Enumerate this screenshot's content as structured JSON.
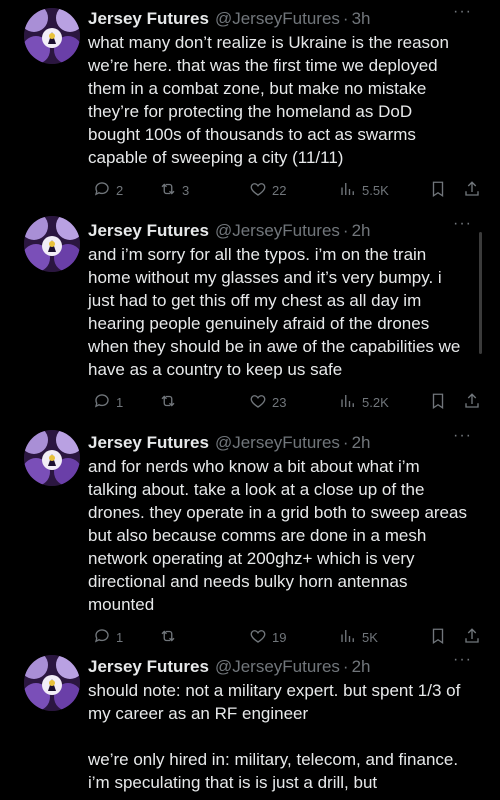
{
  "tweets": [
    {
      "name": "Jersey Futures",
      "handle": "@JerseyFutures",
      "time": "3h",
      "text": "what many don’t realize is Ukraine is the reason we’re here. that was the first time we deployed them in a combat zone, but make no mistake they’re for protecting the homeland as DoD bought 100s of thousands to act as swarms capable of sweeping a city (11/11)",
      "replies": "2",
      "retweets": "3",
      "likes": "22",
      "views": "5.5K"
    },
    {
      "name": "Jersey Futures",
      "handle": "@JerseyFutures",
      "time": "2h",
      "text": "and i’m sorry for all the typos. i’m on the train home without my glasses and it’s very bumpy. i just had to get this off my chest as all day im hearing people genuinely afraid of the drones when they should be in awe of the capabilities we have as a country to keep us safe",
      "replies": "1",
      "retweets": "",
      "likes": "23",
      "views": "5.2K"
    },
    {
      "name": "Jersey Futures",
      "handle": "@JerseyFutures",
      "time": "2h",
      "text": "and for nerds who know a bit about what i’m talking about. take a look at a close up of the drones. they operate in a grid both to sweep areas but also because comms are done in a mesh network operating at 200ghz+ which is very directional and needs bulky horn antennas mounted",
      "replies": "1",
      "retweets": "",
      "likes": "19",
      "views": "5K"
    },
    {
      "name": "Jersey Futures",
      "handle": "@JerseyFutures",
      "time": "2h",
      "text": "should note: not a military expert. but spent 1/3 of my career as an RF engineer\n\nwe’re only hired in: military, telecom, and finance. i’m speculating that is is just a drill, but",
      "replies": "",
      "retweets": "",
      "likes": "",
      "views": ""
    }
  ],
  "ui": {
    "more_glyph": "···",
    "dot": "·",
    "colors": {
      "background": "#000000",
      "text": "#e7e9ea",
      "muted": "#71767b"
    },
    "icons": [
      "reply-icon",
      "retweet-icon",
      "like-icon",
      "views-icon",
      "bookmark-icon",
      "share-icon"
    ]
  }
}
